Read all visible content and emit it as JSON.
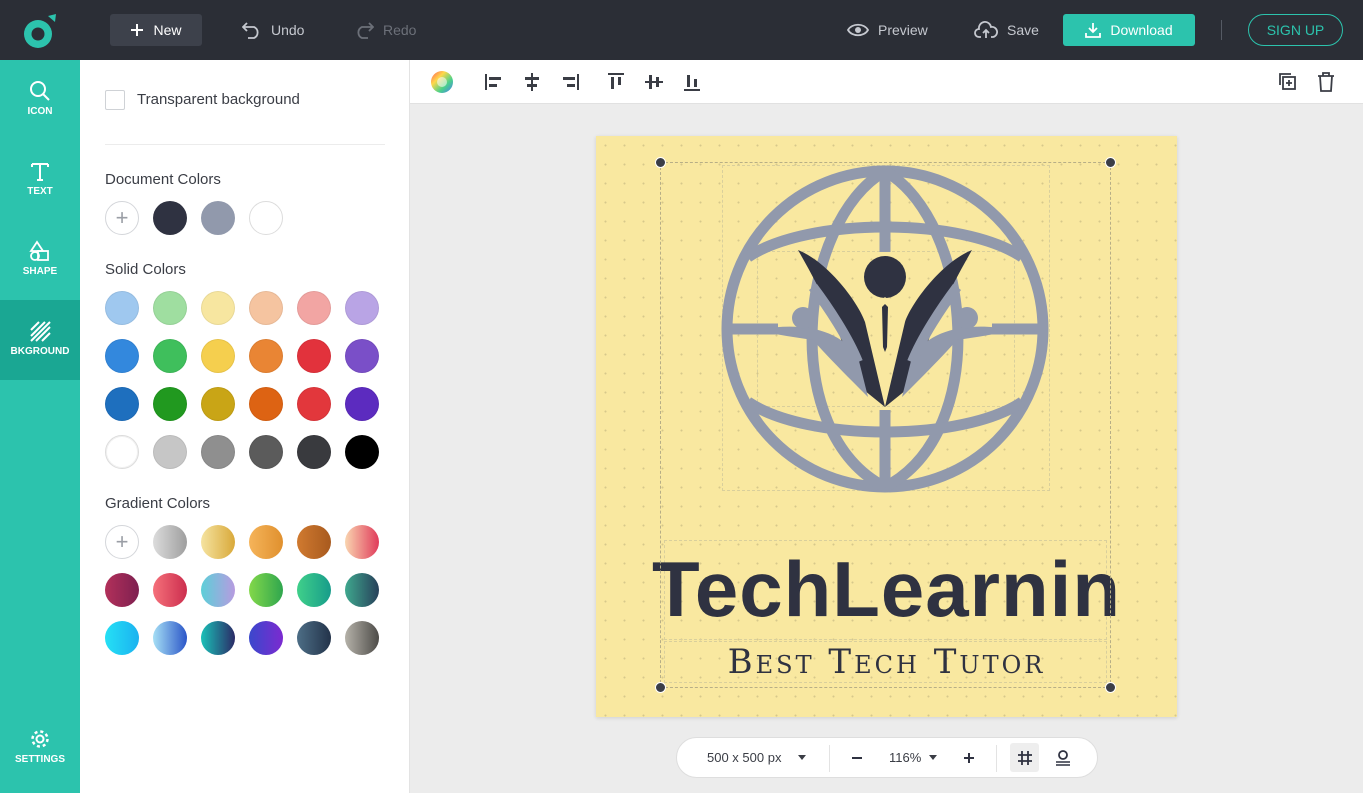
{
  "topbar": {
    "new_label": "New",
    "undo_label": "Undo",
    "redo_label": "Redo",
    "preview_label": "Preview",
    "save_label": "Save",
    "download_label": "Download",
    "signup_label": "SIGN UP"
  },
  "rail": {
    "items": [
      {
        "label": "ICON",
        "icon": "search-icon"
      },
      {
        "label": "TEXT",
        "icon": "text-icon"
      },
      {
        "label": "SHAPE",
        "icon": "shape-icon"
      },
      {
        "label": "BKGROUND",
        "icon": "background-icon",
        "active": true
      },
      {
        "label": "SETTINGS",
        "icon": "gear-icon"
      }
    ]
  },
  "panel": {
    "transparent_label": "Transparent background",
    "transparent_checked": false,
    "document_colors_title": "Document Colors",
    "document_colors": [
      "#2f3241",
      "#9199ac",
      "#ffffff"
    ],
    "solid_colors_title": "Solid Colors",
    "solid_colors": [
      "#9fc8ef",
      "#9fdea0",
      "#f7e6a0",
      "#f5c4a0",
      "#f2a5a3",
      "#b9a4e5",
      "#3388dd",
      "#3fbf5c",
      "#f5cf4e",
      "#e98534",
      "#e2323c",
      "#7a4fc8",
      "#1e6fbe",
      "#21991f",
      "#c9a516",
      "#dd6313",
      "#e2373c",
      "#5c2bbf",
      "#ffffff",
      "#c6c6c6",
      "#8f8f8f",
      "#5b5b5b",
      "#393a3e",
      "#000000"
    ],
    "gradient_colors_title": "Gradient Colors",
    "gradient_colors": [
      [
        "#dcdcdc",
        "#9e9e9e"
      ],
      [
        "#f5e3a0",
        "#d9a93a"
      ],
      [
        "#f5b45a",
        "#e0902e"
      ],
      [
        "#d07a30",
        "#a85a1e"
      ],
      [
        "#f9d5b0",
        "#e03a5a"
      ],
      [
        "#b2305a",
        "#7e2050"
      ],
      [
        "#f5707a",
        "#cc2e4e"
      ],
      [
        "#5ccfd8",
        "#b79be0"
      ],
      [
        "#83d84a",
        "#2fa64e"
      ],
      [
        "#40d08a",
        "#179c8a"
      ],
      [
        "#3fa88e",
        "#27405a"
      ],
      [
        "#25e0f5",
        "#1bb2f0"
      ],
      [
        "#a6dff5",
        "#2b56c8"
      ],
      [
        "#1ac1b8",
        "#2b2a66"
      ],
      [
        "#3a48cc",
        "#7c2ad0"
      ],
      [
        "#4d6e86",
        "#23334a"
      ],
      [
        "#b5b2a9",
        "#4d4b48"
      ]
    ]
  },
  "artboard": {
    "background": "#f9e8a0",
    "title": "TechLearnin",
    "tagline": "Best Tech Tutor",
    "emblem_primary": "#9199ac",
    "emblem_dark": "#2f3241"
  },
  "bottombar": {
    "size_label": "500 x 500 px",
    "zoom_label": "116%"
  },
  "colors": {
    "topbar": "#2b2e36",
    "accent": "#2cc3ad",
    "accent_active": "#1aa793"
  }
}
